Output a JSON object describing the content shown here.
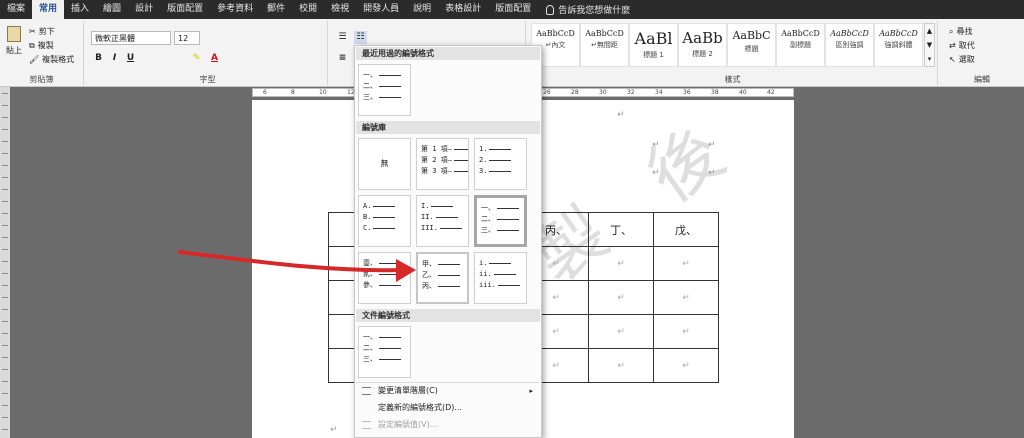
{
  "tabs": [
    "檔案",
    "常用",
    "插入",
    "繪圖",
    "設計",
    "版面配置",
    "參考資料",
    "郵件",
    "校閱",
    "檢視",
    "開發人員",
    "說明",
    "表格設計",
    "版面配置"
  ],
  "active_tab_index": 1,
  "tell_me": "告訴我您想做什麼",
  "ribbon": {
    "clipboard": {
      "paste": "貼上",
      "cut": "剪下",
      "copy": "複製",
      "format_painter": "複製格式",
      "label": "剪貼簿"
    },
    "font": {
      "font_name": "微軟正黑體",
      "font_size": "12",
      "label": "字型",
      "buttons": [
        "B",
        "I",
        "U"
      ]
    },
    "styles": {
      "label": "樣式",
      "items": [
        {
          "sample": "AaBbCcD",
          "name": "↵內文"
        },
        {
          "sample": "AaBbCcD",
          "name": "↵無間距"
        },
        {
          "sample": "AaBl",
          "name": "標題 1"
        },
        {
          "sample": "AaBb",
          "name": "標題 2"
        },
        {
          "sample": "AaBbC",
          "name": "標題"
        },
        {
          "sample": "AaBbCcD",
          "name": "副標題"
        },
        {
          "sample": "AaBbCcD",
          "name": "區別強調"
        },
        {
          "sample": "AaBbCcD",
          "name": "強調斜體"
        }
      ]
    },
    "editing": {
      "find": "尋找",
      "replace": "取代",
      "select": "選取",
      "label": "編輯"
    }
  },
  "ruler_numbers": [
    "6",
    "8",
    "10",
    "12",
    "14",
    "16",
    "18",
    "20",
    "22",
    "24",
    "26",
    "28",
    "30",
    "32",
    "34",
    "36",
    "38",
    "40",
    "42"
  ],
  "numbering_menu": {
    "recent_header": "最近用過的編號格式",
    "recent_items": [
      [
        "一、",
        "二、",
        "三、"
      ]
    ],
    "library_header": "編號庫",
    "library_none": "無",
    "library_items": [
      [
        "第 1 項—",
        "第 2 項—",
        "第 3 項—"
      ],
      [
        "1.",
        "2.",
        "3."
      ],
      [
        "A.",
        "B.",
        "C."
      ],
      [
        "I.",
        "II.",
        "III."
      ],
      [
        "一、",
        "二、",
        "三、"
      ],
      [
        "壹、",
        "貳、",
        "參、"
      ],
      [
        "甲、",
        "乙、",
        "丙、"
      ],
      [
        "i.",
        "ii.",
        "iii."
      ]
    ],
    "document_header": "文件編號格式",
    "document_items": [
      [
        "一、",
        "二、",
        "三、"
      ]
    ],
    "commands": [
      {
        "label": "變更清單階層(C)",
        "enabled": true
      },
      {
        "label": "定義新的編號格式(D)...",
        "enabled": true
      },
      {
        "label": "設定編號值(V)...",
        "enabled": false
      }
    ]
  },
  "document": {
    "paragraph_mark": "↵",
    "table_header": [
      "",
      "",
      "丙、",
      "丁、",
      "戊、"
    ],
    "table_rows": 5
  },
  "colors": {
    "accent": "#2b579a",
    "arrow": "#d62828"
  }
}
